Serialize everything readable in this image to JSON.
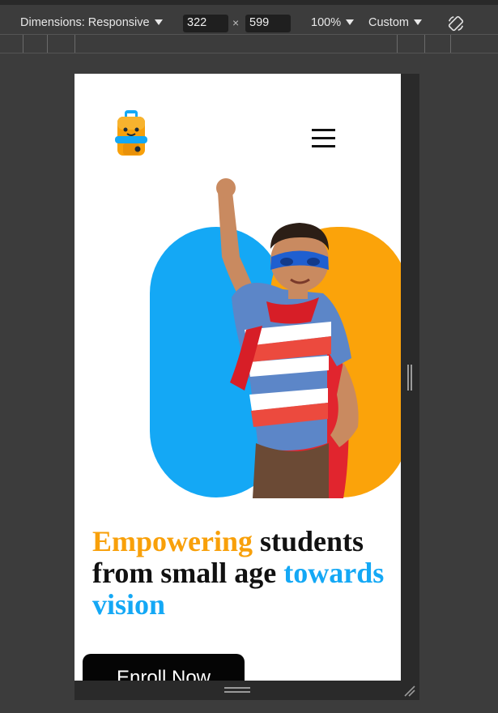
{
  "devtools": {
    "dimensions_label": "Dimensions: Responsive",
    "width_value": "322",
    "times_sign": "×",
    "height_value": "599",
    "zoom_label": "100%",
    "throttle_label": "Custom"
  },
  "site": {
    "headline": {
      "word1": "Empowering",
      "part2": " students from small age ",
      "word3": "towards vision"
    },
    "cta_label": "Enroll Now",
    "colors": {
      "orange": "#f8a00a",
      "blue": "#14a8f5",
      "button": "#050505"
    },
    "icons": [
      "backpack-logo-icon",
      "hamburger-menu-icon",
      "rotate-device-icon"
    ]
  }
}
